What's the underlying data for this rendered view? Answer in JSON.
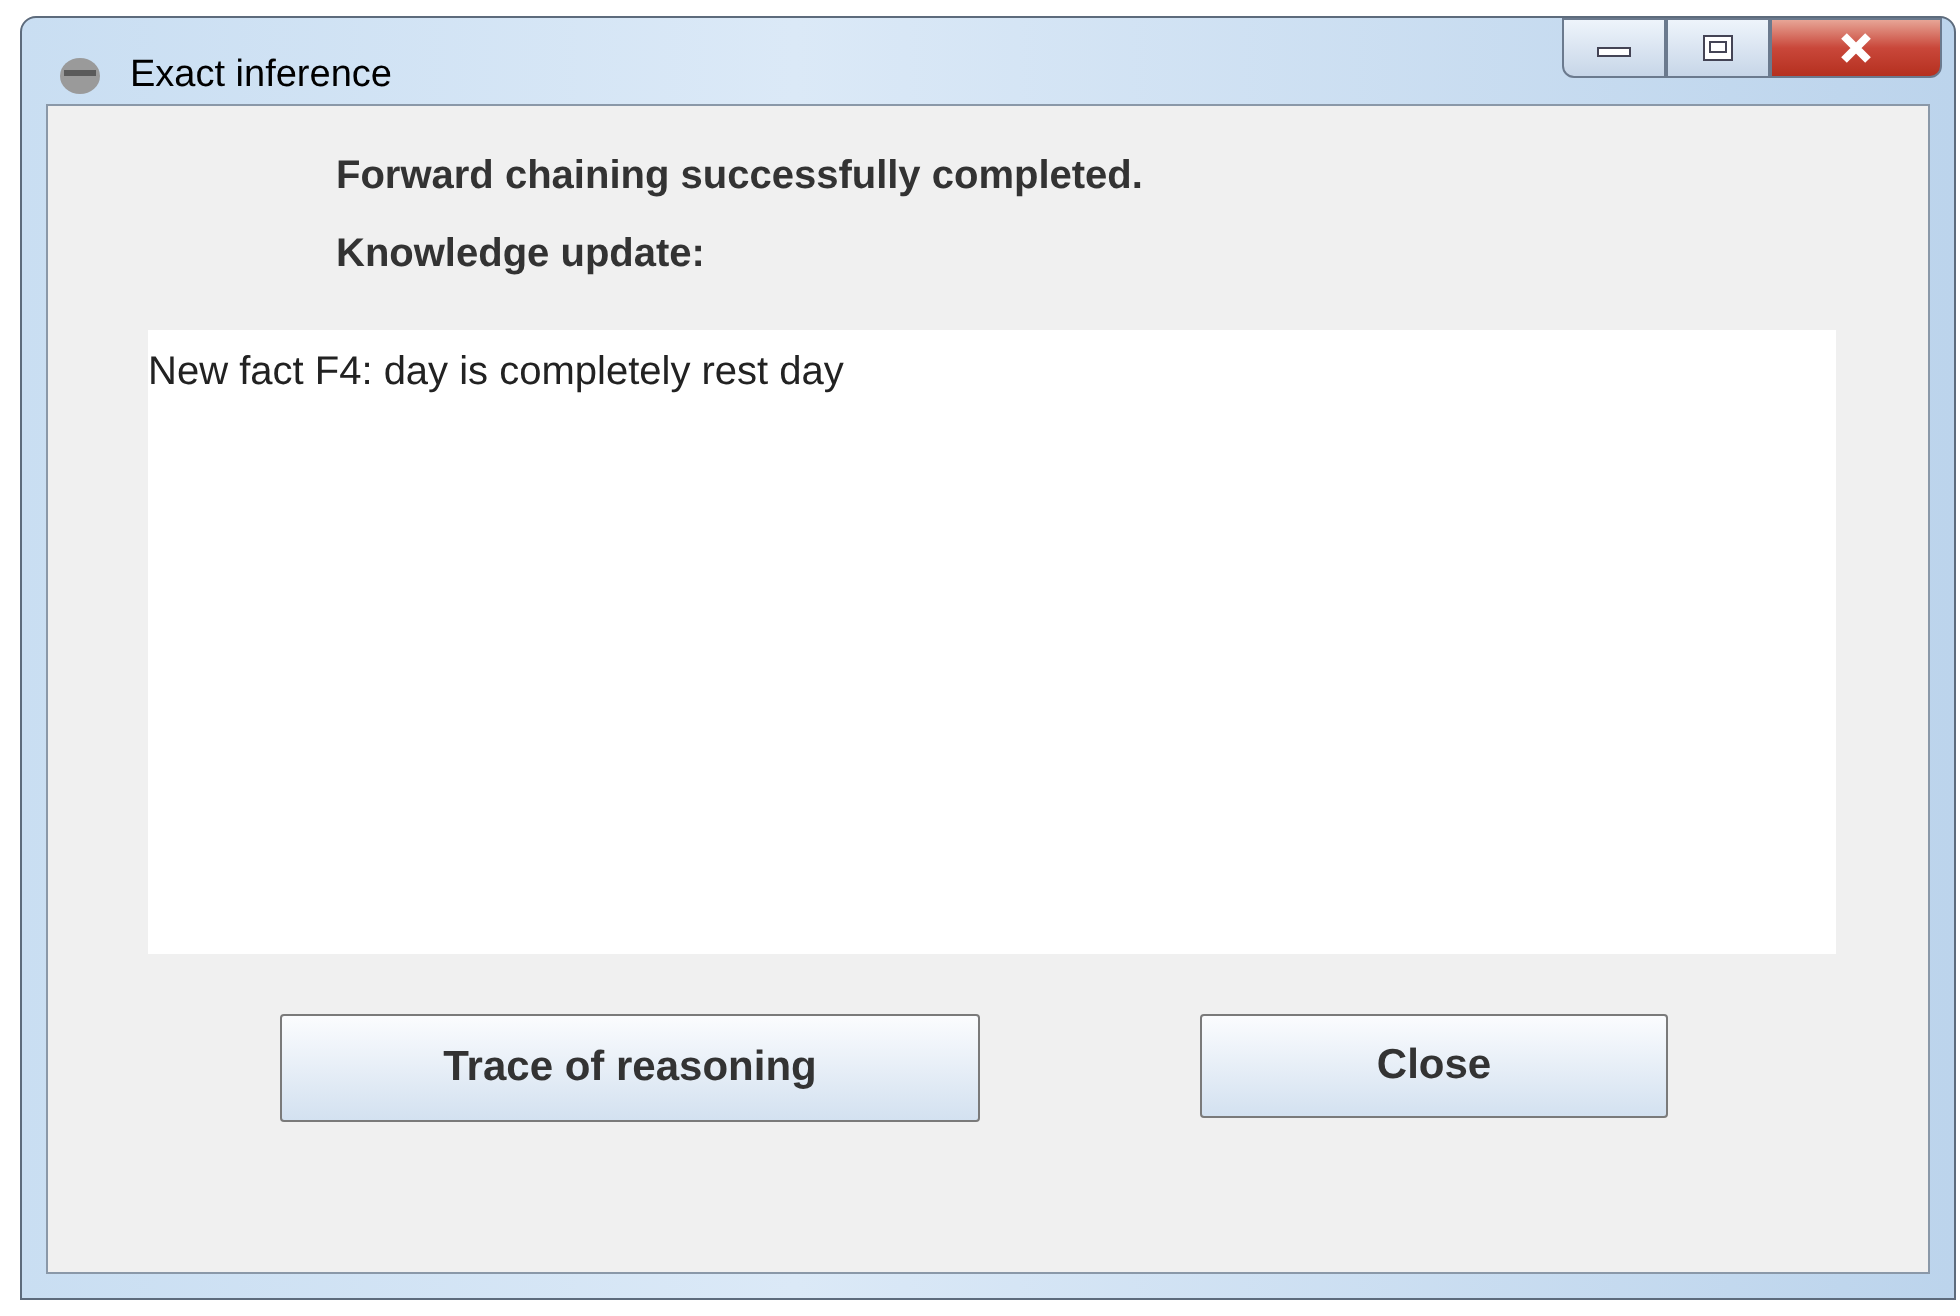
{
  "window": {
    "title": "Exact inference"
  },
  "message": "Forward chaining successfully completed.",
  "section_label": "Knowledge update:",
  "output": {
    "lines": [
      "New fact F4: day is completely rest day"
    ]
  },
  "buttons": [
    "Trace of reasoning",
    "Close"
  ]
}
